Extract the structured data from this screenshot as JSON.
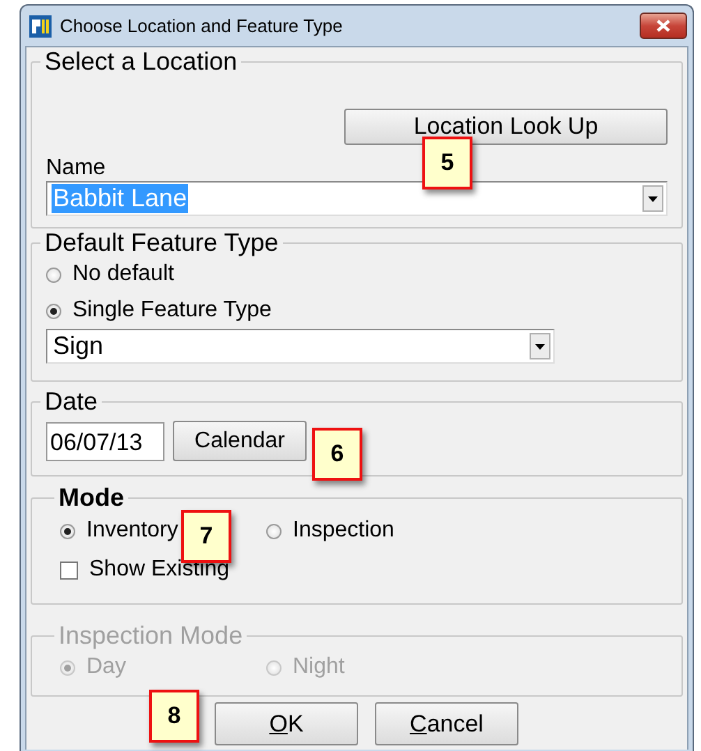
{
  "window": {
    "title": "Choose Location and Feature Type"
  },
  "location": {
    "legend": "Select a Location",
    "lookup_button": "Location Look Up",
    "name_label": "Name",
    "name_value": "Babbit Lane",
    "name_selected": true
  },
  "feature_type": {
    "legend": "Default Feature Type",
    "options": [
      {
        "label": "No default",
        "selected": false
      },
      {
        "label": "Single Feature Type",
        "selected": true
      }
    ],
    "value": "Sign"
  },
  "date": {
    "legend": "Date",
    "value": "06/07/13",
    "calendar_button": "Calendar"
  },
  "mode": {
    "legend": "Mode",
    "options": [
      {
        "label": "Inventory",
        "selected": true
      },
      {
        "label": "Inspection",
        "selected": false
      }
    ],
    "show_existing": {
      "label": "Show Existing",
      "checked": false
    }
  },
  "inspection_mode": {
    "legend": "Inspection Mode",
    "disabled": true,
    "options": [
      {
        "label": "Day",
        "selected": true
      },
      {
        "label": "Night",
        "selected": false
      }
    ]
  },
  "buttons": [
    {
      "mnemonic": "O",
      "rest": "K"
    },
    {
      "mnemonic": "C",
      "rest": "ancel"
    }
  ],
  "callouts": [
    "5",
    "6",
    "7",
    "8"
  ]
}
